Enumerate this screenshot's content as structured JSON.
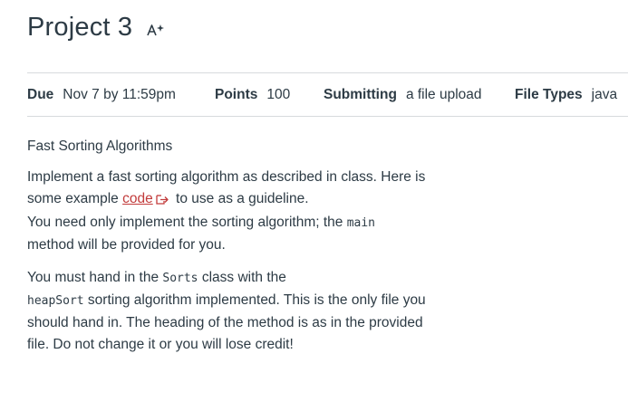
{
  "assignment": {
    "title": "Project 3",
    "icon": "ai-sparkle-icon"
  },
  "details": {
    "due_label": "Due",
    "due_value": "Nov 7 by 11:59pm",
    "points_label": "Points",
    "points_value": "100",
    "submitting_label": "Submitting",
    "submitting_value": "a file upload",
    "filetypes_label": "File Types",
    "filetypes_value": "java"
  },
  "description": {
    "heading": "Fast Sorting Algorithms",
    "p1_part1": "Implement a fast sorting algorithm as described in class. Here is some example ",
    "p1_link": "code",
    "p1_part2": " to use as a guideline.",
    "p1_part3": "You need only implement the sorting algorithm; the ",
    "p1_code_main": "main",
    "p1_part4": " method will be provided for you.",
    "p2_part1": "You must hand in the ",
    "p2_code_sorts": "Sorts",
    "p2_part2": " class with the",
    "p2_code_heapsort": "heapSort",
    "p2_part3": " sorting algorithm implemented. This is the only file you should hand in. The heading of the method is as in the provided file. Do not change it or you will lose credit!"
  },
  "colors": {
    "text": "#2d3b45",
    "link": "#c23b3b",
    "divider": "#d7dadd"
  }
}
